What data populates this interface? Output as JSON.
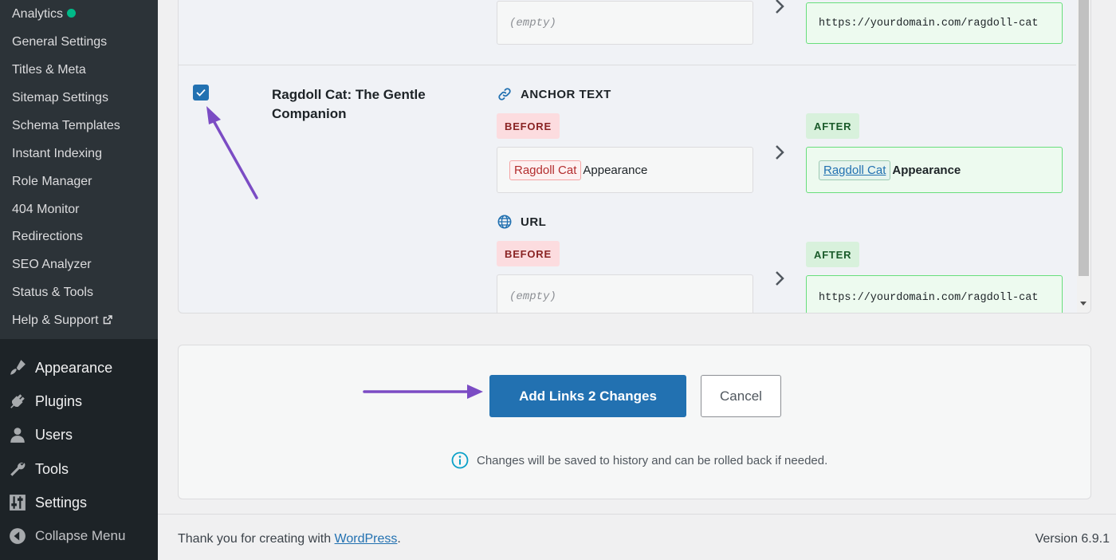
{
  "sidebar": {
    "submenu": [
      {
        "label": "Analytics",
        "status_dot": "#00ba88"
      },
      {
        "label": "General Settings"
      },
      {
        "label": "Titles & Meta"
      },
      {
        "label": "Sitemap Settings"
      },
      {
        "label": "Schema Templates"
      },
      {
        "label": "Instant Indexing"
      },
      {
        "label": "Role Manager"
      },
      {
        "label": "404 Monitor"
      },
      {
        "label": "Redirections"
      },
      {
        "label": "SEO Analyzer"
      },
      {
        "label": "Status & Tools"
      },
      {
        "label": "Help & Support",
        "icon": "external-link-icon"
      }
    ],
    "menu": [
      {
        "label": "Appearance",
        "icon": "paintbrush-icon"
      },
      {
        "label": "Plugins",
        "icon": "plugin-icon"
      },
      {
        "label": "Users",
        "icon": "user-icon"
      },
      {
        "label": "Tools",
        "icon": "wrench-icon"
      },
      {
        "label": "Settings",
        "icon": "settings-icon"
      },
      {
        "label": "Collapse Menu",
        "icon": "collapse-icon"
      }
    ]
  },
  "upper_row": {
    "before_value": "(empty)",
    "after_value": "https://yourdomain.com/ragdoll-cat"
  },
  "item": {
    "checked": true,
    "title": "Ragdoll Cat: The Gentle Companion",
    "anchor_section": {
      "heading": "ANCHOR TEXT",
      "before_badge": "BEFORE",
      "after_badge": "AFTER",
      "before_highlight": "Ragdoll Cat",
      "before_rest": "Appearance",
      "after_link": "Ragdoll Cat",
      "after_rest": "Appearance"
    },
    "url_section": {
      "heading": "URL",
      "before_badge": "BEFORE",
      "after_badge": "AFTER",
      "before_value": "(empty)",
      "after_value": "https://yourdomain.com/ragdoll-cat"
    }
  },
  "actions": {
    "primary_label": "Add Links 2 Changes",
    "cancel_label": "Cancel",
    "note": "Changes will be saved to history and can be rolled back if needed."
  },
  "footer": {
    "thanks_prefix": "Thank you for creating with ",
    "thanks_link": "WordPress",
    "thanks_suffix": ".",
    "version": "Version 6.9.1"
  },
  "colors": {
    "primary": "#2271b1",
    "annotation_arrow": "#7b4cc4",
    "after_border": "#68de7c",
    "before_badge_bg": "#fcdcdf"
  }
}
